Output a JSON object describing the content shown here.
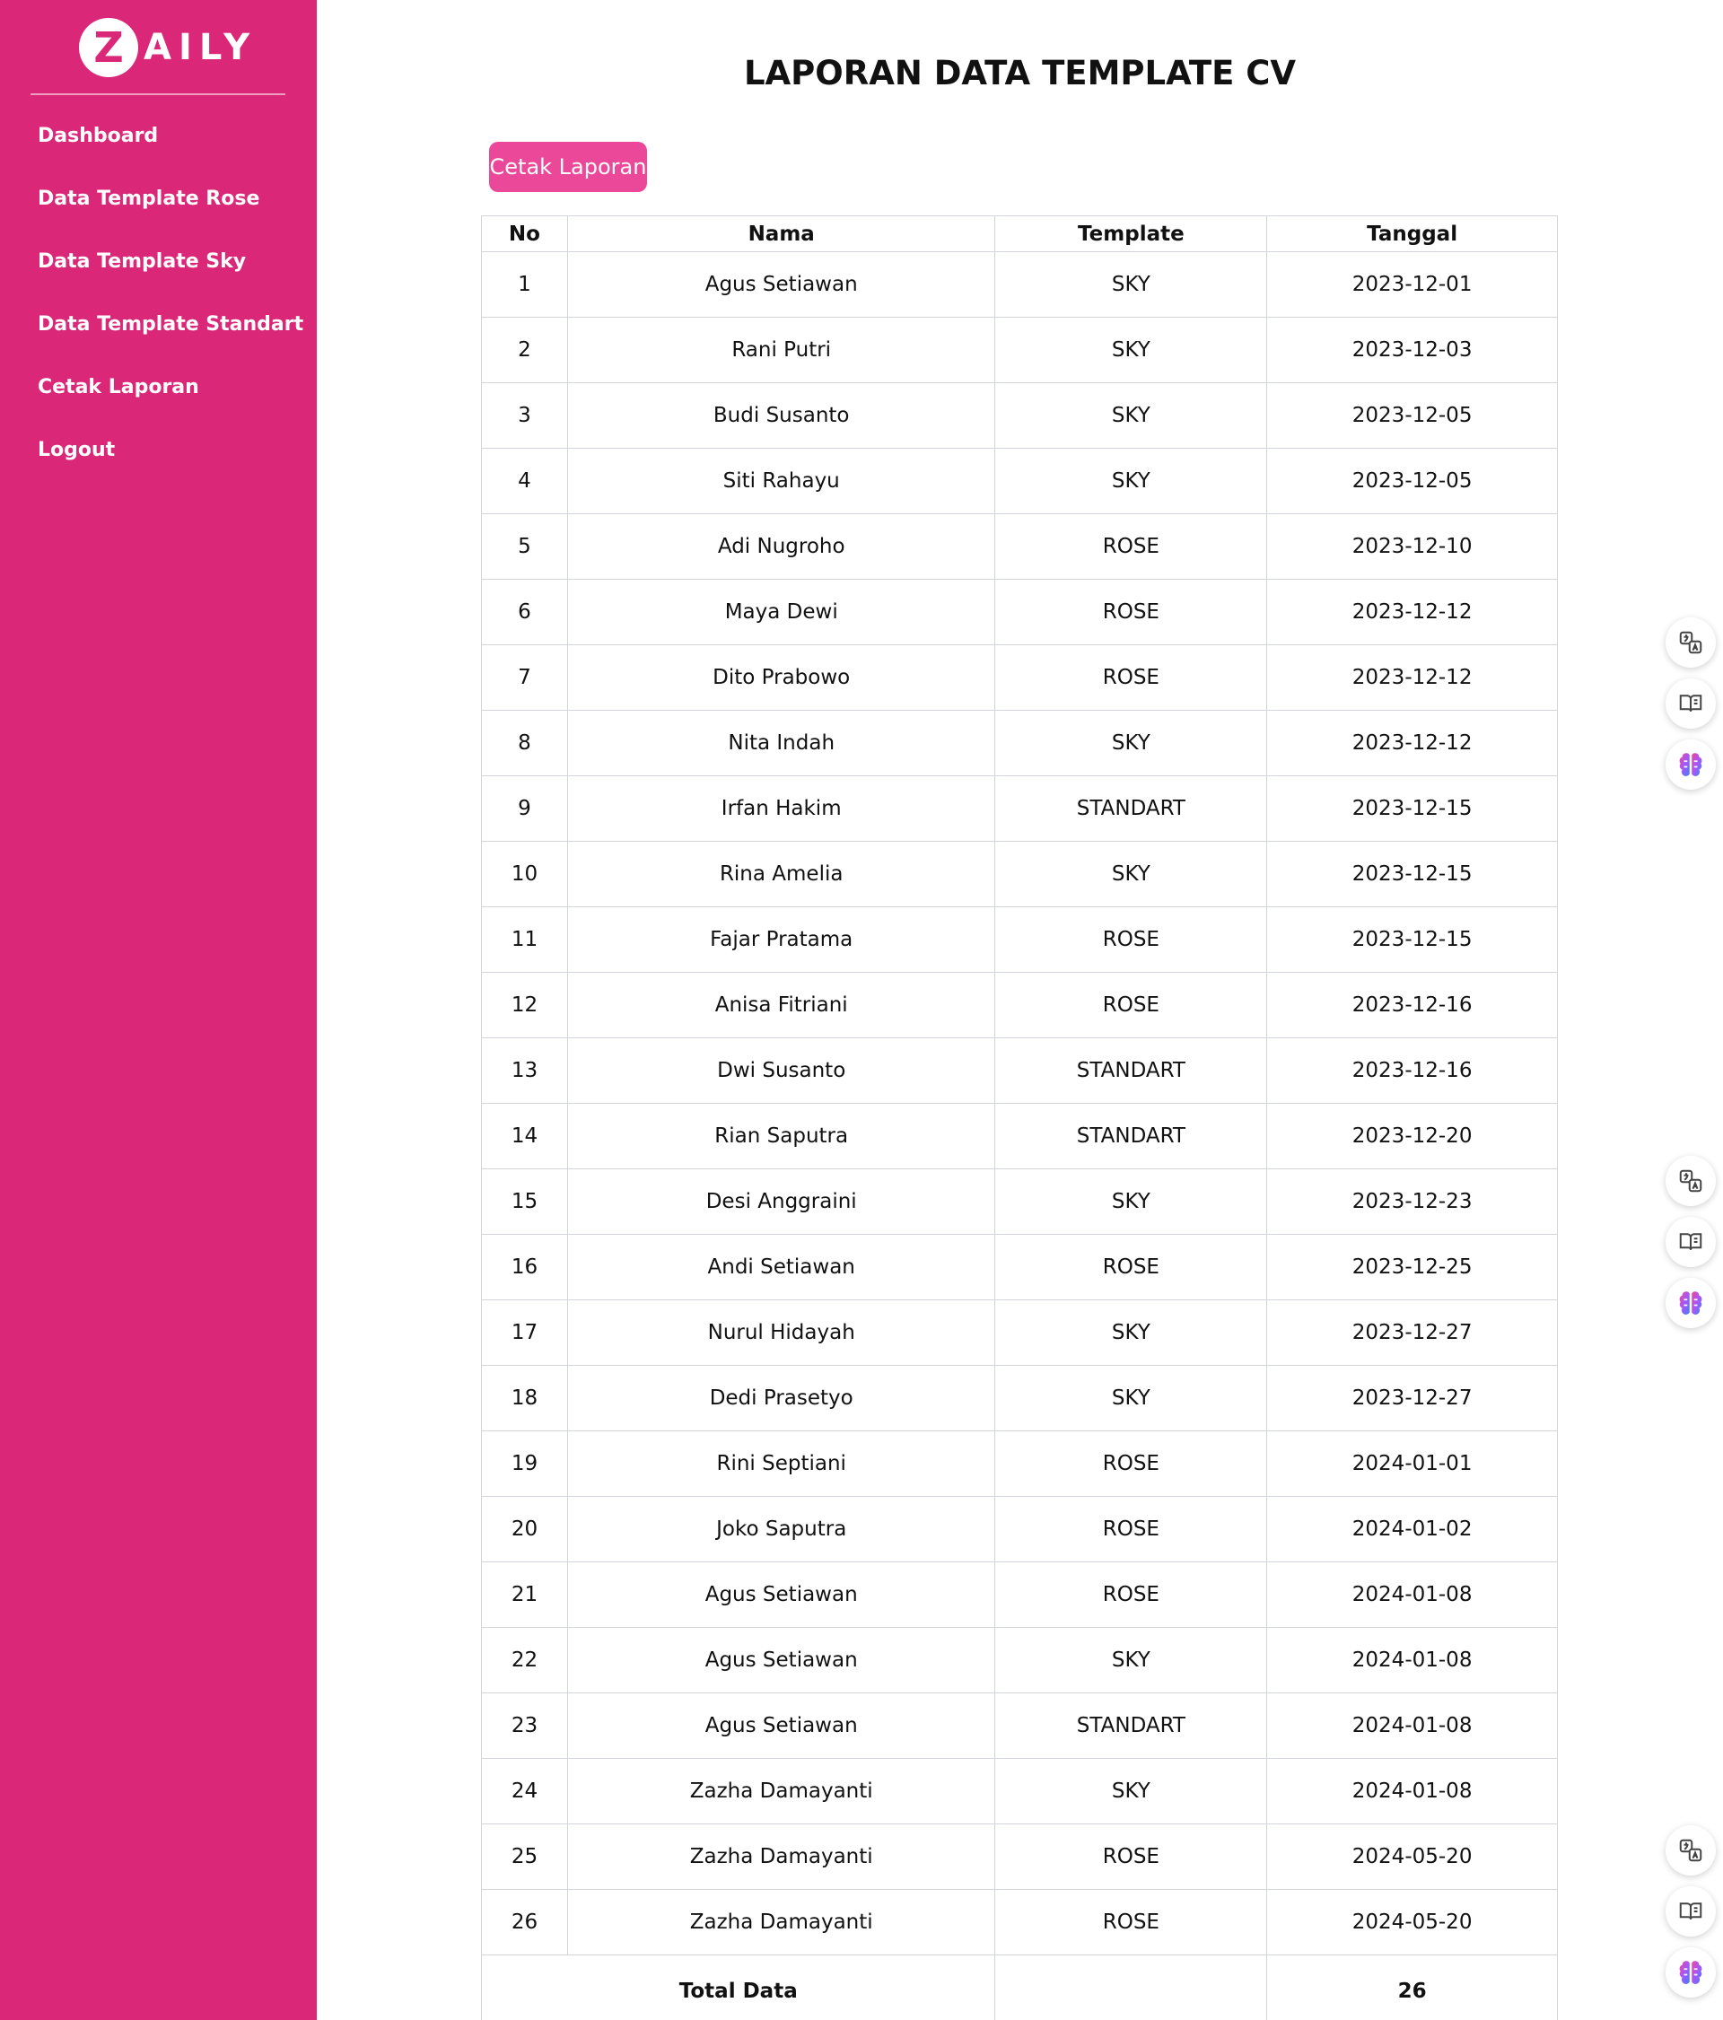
{
  "brand": {
    "logo_letter": "Z",
    "logo_text": "AILY"
  },
  "nav": [
    {
      "label": "Dashboard"
    },
    {
      "label": "Data Template Rose"
    },
    {
      "label": "Data Template Sky"
    },
    {
      "label": "Data Template Standart"
    },
    {
      "label": "Cetak Laporan"
    },
    {
      "label": "Logout"
    }
  ],
  "page": {
    "title": "LAPORAN DATA TEMPLATE CV",
    "print_button": "Cetak Laporan"
  },
  "table": {
    "headers": [
      "No",
      "Nama",
      "Template",
      "Tanggal"
    ],
    "rows": [
      [
        "1",
        "Agus Setiawan",
        "SKY",
        "2023-12-01"
      ],
      [
        "2",
        "Rani Putri",
        "SKY",
        "2023-12-03"
      ],
      [
        "3",
        "Budi Susanto",
        "SKY",
        "2023-12-05"
      ],
      [
        "4",
        "Siti Rahayu",
        "SKY",
        "2023-12-05"
      ],
      [
        "5",
        "Adi Nugroho",
        "ROSE",
        "2023-12-10"
      ],
      [
        "6",
        "Maya Dewi",
        "ROSE",
        "2023-12-12"
      ],
      [
        "7",
        "Dito Prabowo",
        "ROSE",
        "2023-12-12"
      ],
      [
        "8",
        "Nita Indah",
        "SKY",
        "2023-12-12"
      ],
      [
        "9",
        "Irfan Hakim",
        "STANDART",
        "2023-12-15"
      ],
      [
        "10",
        "Rina Amelia",
        "SKY",
        "2023-12-15"
      ],
      [
        "11",
        "Fajar Pratama",
        "ROSE",
        "2023-12-15"
      ],
      [
        "12",
        "Anisa Fitriani",
        "ROSE",
        "2023-12-16"
      ],
      [
        "13",
        "Dwi Susanto",
        "STANDART",
        "2023-12-16"
      ],
      [
        "14",
        "Rian Saputra",
        "STANDART",
        "2023-12-20"
      ],
      [
        "15",
        "Desi Anggraini",
        "SKY",
        "2023-12-23"
      ],
      [
        "16",
        "Andi Setiawan",
        "ROSE",
        "2023-12-25"
      ],
      [
        "17",
        "Nurul Hidayah",
        "SKY",
        "2023-12-27"
      ],
      [
        "18",
        "Dedi Prasetyo",
        "SKY",
        "2023-12-27"
      ],
      [
        "19",
        "Rini Septiani",
        "ROSE",
        "2024-01-01"
      ],
      [
        "20",
        "Joko Saputra",
        "ROSE",
        "2024-01-02"
      ],
      [
        "21",
        "Agus Setiawan",
        "ROSE",
        "2024-01-08"
      ],
      [
        "22",
        "Agus Setiawan",
        "SKY",
        "2024-01-08"
      ],
      [
        "23",
        "Agus Setiawan",
        "STANDART",
        "2024-01-08"
      ],
      [
        "24",
        "Zazha Damayanti",
        "SKY",
        "2024-01-08"
      ],
      [
        "25",
        "Zazha Damayanti",
        "ROSE",
        "2024-05-20"
      ],
      [
        "26",
        "Zazha Damayanti",
        "ROSE",
        "2024-05-20"
      ]
    ],
    "footer": {
      "label": "Total Data",
      "value": "26"
    }
  },
  "floating_widgets": [
    {
      "icons": [
        "translate-icon",
        "book-icon",
        "brain-icon"
      ]
    },
    {
      "icons": [
        "translate-icon",
        "book-icon",
        "brain-icon"
      ]
    },
    {
      "icons": [
        "translate-icon",
        "book-icon",
        "brain-icon"
      ]
    }
  ],
  "colors": {
    "sidebar": "#db2777",
    "button": "#ec4899",
    "border": "#d1d5db"
  }
}
